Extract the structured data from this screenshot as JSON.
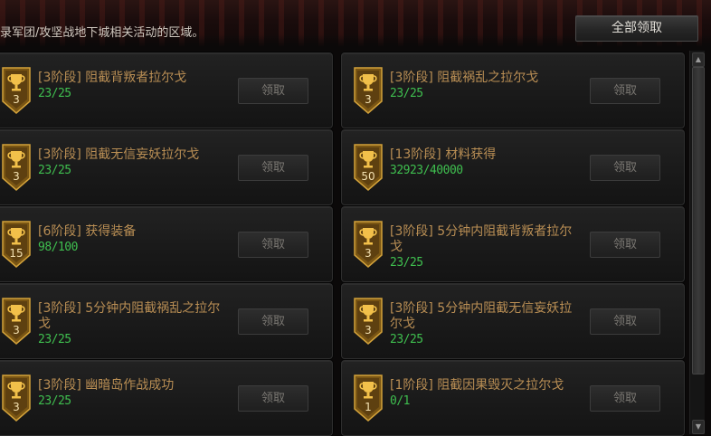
{
  "header": {
    "description": "录军团/攻坚战地下城相关活动的区域。",
    "claim_all_label": "全部领取"
  },
  "colors": {
    "title": "#b98e54",
    "progress": "#3fbf4f",
    "badge_fill": "#8a6418",
    "badge_border": "#d3a23a"
  },
  "achievements": [
    {
      "title": "[3阶段] 阻截背叛者拉尔戈",
      "progress": "23/25",
      "level": "3",
      "claim_label": "领取",
      "icon": "trophy-icon"
    },
    {
      "title": "[3阶段] 阻截祸乱之拉尔戈",
      "progress": "23/25",
      "level": "3",
      "claim_label": "领取",
      "icon": "trophy-icon"
    },
    {
      "title": "[3阶段] 阻截无信妄妖拉尔戈",
      "progress": "23/25",
      "level": "3",
      "claim_label": "领取",
      "icon": "trophy-icon"
    },
    {
      "title": "[13阶段] 材料获得",
      "progress": "32923/40000",
      "level": "50",
      "claim_label": "领取",
      "icon": "trophy-icon"
    },
    {
      "title": "[6阶段] 获得装备",
      "progress": "98/100",
      "level": "15",
      "claim_label": "领取",
      "icon": "trophy-icon"
    },
    {
      "title": "[3阶段] 5分钟内阻截背叛者拉尔戈",
      "progress": "23/25",
      "level": "3",
      "claim_label": "领取",
      "icon": "trophy-icon"
    },
    {
      "title": "[3阶段] 5分钟内阻截祸乱之拉尔戈",
      "progress": "23/25",
      "level": "3",
      "claim_label": "领取",
      "icon": "trophy-icon"
    },
    {
      "title": "[3阶段] 5分钟内阻截无信妄妖拉尔戈",
      "progress": "23/25",
      "level": "3",
      "claim_label": "领取",
      "icon": "trophy-icon"
    },
    {
      "title": "[3阶段] 幽暗岛作战成功",
      "progress": "23/25",
      "level": "3",
      "claim_label": "领取",
      "icon": "trophy-icon"
    },
    {
      "title": "[1阶段] 阻截因果毁灭之拉尔戈",
      "progress": "0/1",
      "level": "1",
      "claim_label": "领取",
      "icon": "trophy-icon"
    }
  ]
}
